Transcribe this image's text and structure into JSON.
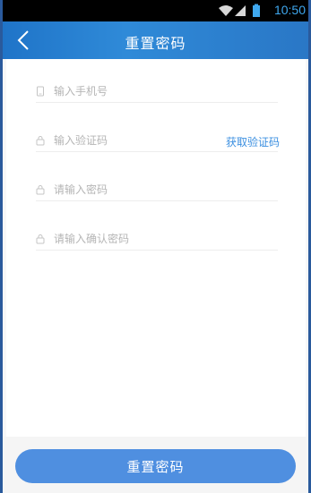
{
  "statusbar": {
    "time": "10:50"
  },
  "header": {
    "title": "重置密码"
  },
  "form": {
    "phone": {
      "placeholder": "输入手机号"
    },
    "code": {
      "placeholder": "输入验证码",
      "get_code_label": "获取验证码"
    },
    "password": {
      "placeholder": "请输入密码"
    },
    "confirm": {
      "placeholder": "请输入确认密码"
    }
  },
  "submit": {
    "label": "重置密码"
  }
}
